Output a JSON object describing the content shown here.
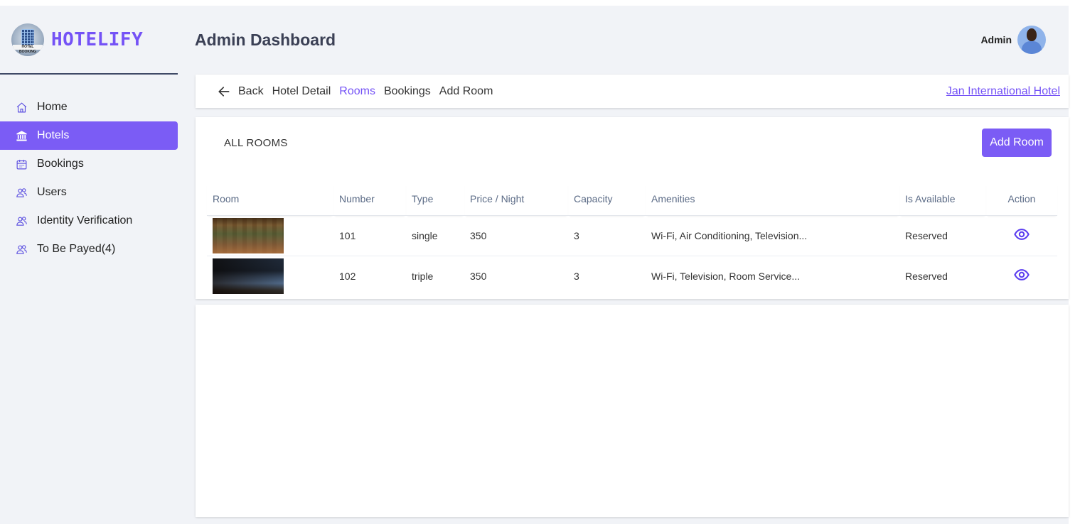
{
  "brand": {
    "name": "HOTELIFY",
    "logo_text": "HOTEL BOOKING"
  },
  "header": {
    "title": "Admin Dashboard",
    "user_name": "Admin"
  },
  "sidebar": {
    "items": [
      {
        "label": "Home",
        "icon": "home-icon",
        "active": false
      },
      {
        "label": "Hotels",
        "icon": "bank-icon",
        "active": true
      },
      {
        "label": "Bookings",
        "icon": "calendar-icon",
        "active": false
      },
      {
        "label": "Users",
        "icon": "users-icon",
        "active": false
      },
      {
        "label": "Identity Verification",
        "icon": "users-icon",
        "active": false
      },
      {
        "label": "To Be Payed(4)",
        "icon": "users-icon",
        "active": false
      }
    ]
  },
  "subnav": {
    "back": "Back",
    "links": [
      "Hotel Detail",
      "Rooms",
      "Bookings",
      "Add Room"
    ],
    "active": "Rooms",
    "hotel": "Jan International Hotel"
  },
  "rooms": {
    "title": "ALL ROOMS",
    "add_button": "Add Room",
    "columns": [
      "Room",
      "Number",
      "Type",
      "Price / Night",
      "Capacity",
      "Amenities",
      "Is Available",
      "Action"
    ],
    "rows": [
      {
        "number": "101",
        "type": "single",
        "price": "350",
        "capacity": "3",
        "amenities": "Wi-Fi, Air Conditioning, Television...",
        "available": "Reserved"
      },
      {
        "number": "102",
        "type": "triple",
        "price": "350",
        "capacity": "3",
        "amenities": "Wi-Fi, Television, Room Service...",
        "available": "Reserved"
      }
    ]
  },
  "colors": {
    "accent": "#7b5cf5",
    "brand": "#7452f6",
    "background": "#f1f3f7"
  }
}
